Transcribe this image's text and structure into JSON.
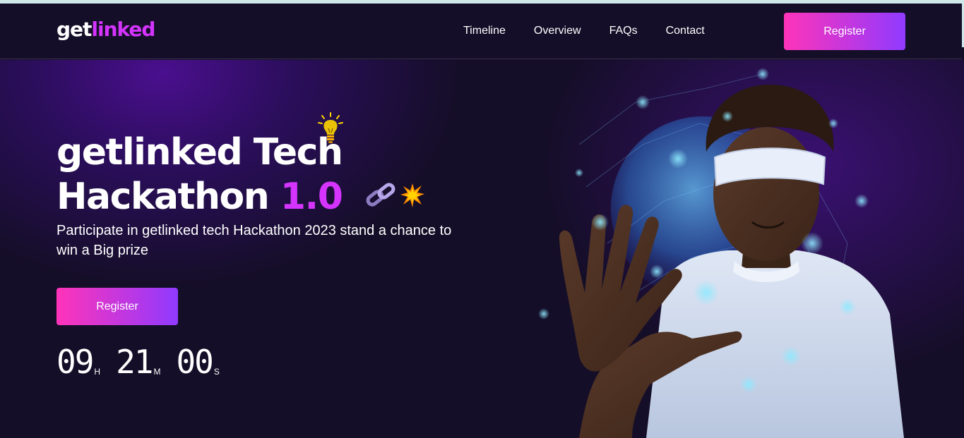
{
  "logo": {
    "part1": "get",
    "part2": "linked"
  },
  "nav": {
    "links": [
      "Timeline",
      "Overview",
      "FAQs",
      "Contact"
    ],
    "register_label": "Register"
  },
  "hero": {
    "title_line1": "getlinked Tech",
    "title_line2": "Hackathon",
    "title_accent": "1.0",
    "subtitle": "Participate in getlinked tech Hackathon 2023 stand a chance to win a Big prize",
    "register_label": "Register",
    "countdown": [
      {
        "value": "09",
        "unit": "H"
      },
      {
        "value": "21",
        "unit": "M"
      },
      {
        "value": "00",
        "unit": "S"
      }
    ]
  },
  "icons": {
    "bulb": "lightbulb-icon",
    "chain": "chain-link-icon",
    "spark": "explosion-icon"
  },
  "colors": {
    "background": "#150e28",
    "accent": "#d434fe",
    "button_gradient_start": "#fe34b9",
    "button_gradient_end": "#903aff"
  }
}
